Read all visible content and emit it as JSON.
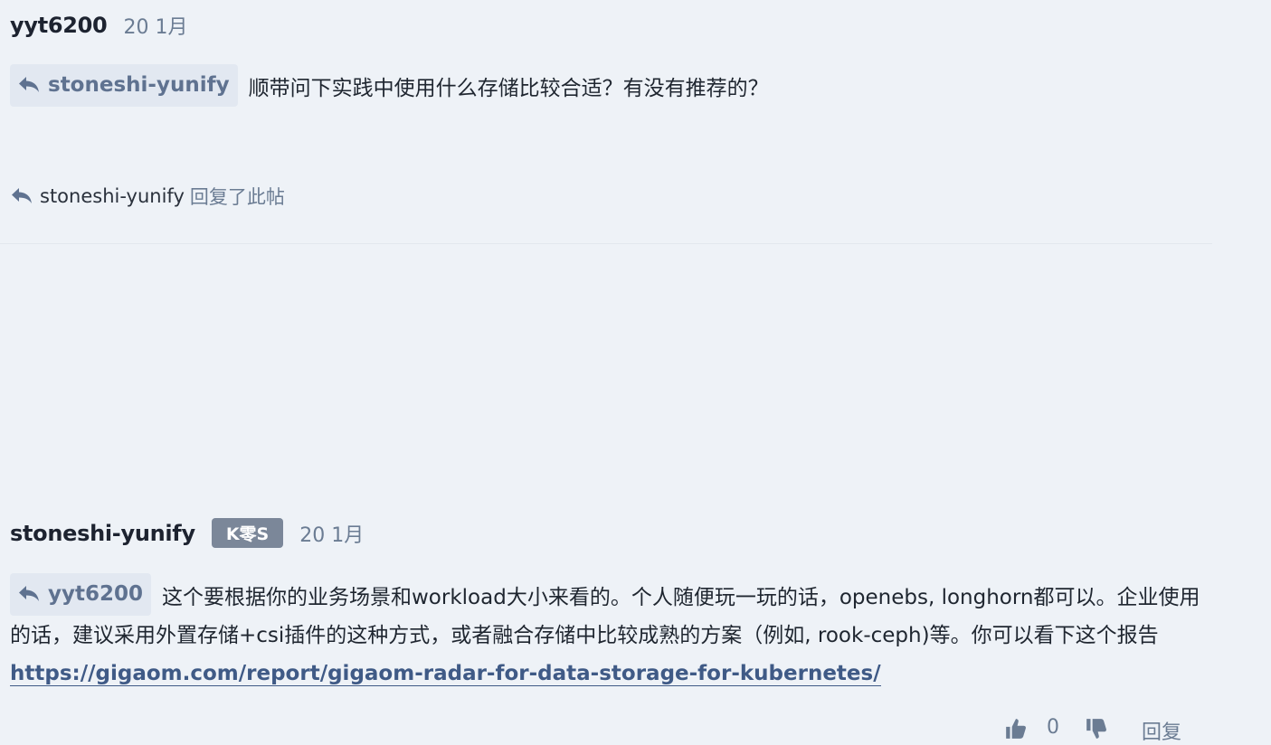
{
  "posts": [
    {
      "username": "yyt6200",
      "time": "20 1月",
      "reply_to": "stoneshi-yunify",
      "content": "顺带问下实践中使用什么存储比较合适？有没有推荐的？",
      "replied_by": "stoneshi-yunify",
      "replied_suffix": "回复了此帖"
    },
    {
      "username": "stoneshi-yunify",
      "badge": "K零S",
      "time": "20 1月",
      "reply_to": "yyt6200",
      "content": "这个要根据你的业务场景和workload大小来看的。个人随便玩一玩的话，openebs, longhorn都可以。企业使用的话，建议采用外置存储+csi插件的这种方式，或者融合存储中比较成熟的方案（例如, rook-ceph)等。你可以看下这个报告 ",
      "link": "https://gigaom.com/report/gigaom-radar-for-data-storage-for-kubernetes/",
      "like_count": "0",
      "reply_label": "回复"
    }
  ],
  "icons": {
    "reply": "reply-arrow-icon",
    "like": "thumbs-up-icon",
    "dislike": "thumbs-down-icon"
  },
  "colors": {
    "background": "#eef2f7",
    "badge": "#7b8799",
    "link": "#3f5a86",
    "muted": "#6b7c93"
  }
}
